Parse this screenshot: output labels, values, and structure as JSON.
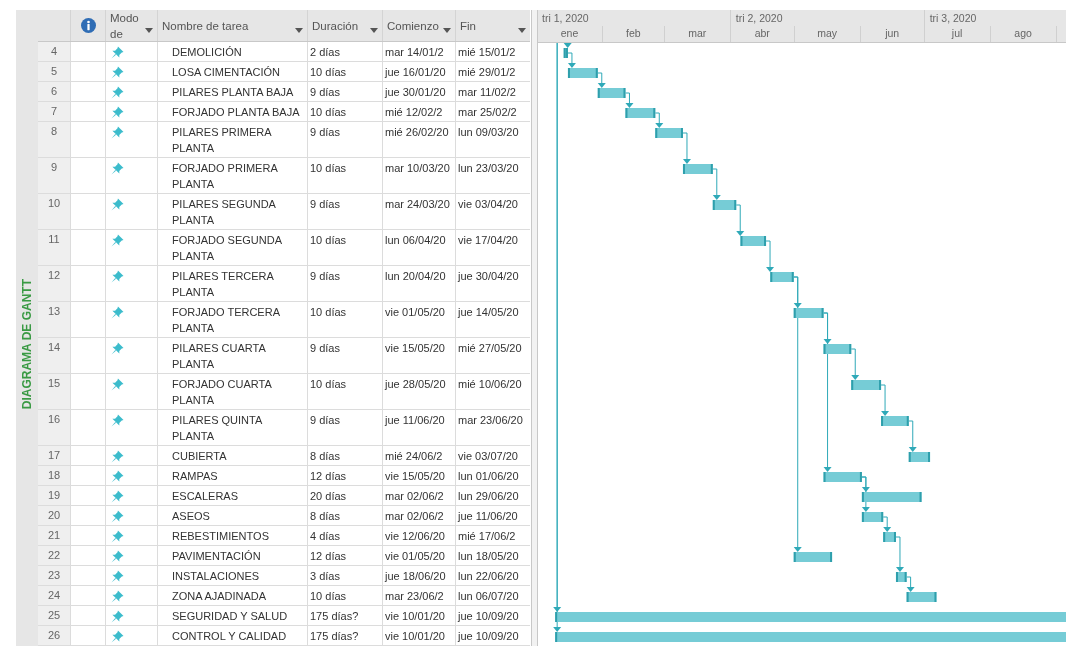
{
  "side_label": "DIAGRAMA DE GANTT",
  "table": {
    "columns": [
      {
        "kind": "info"
      },
      {
        "kind": "sortable",
        "label": "Modo de"
      },
      {
        "kind": "sortable",
        "label": "Nombre de tarea"
      },
      {
        "kind": "sortable",
        "label": "Duración"
      },
      {
        "kind": "sortable",
        "label": "Comienzo"
      },
      {
        "kind": "sortable",
        "label": "Fin"
      }
    ],
    "rows": [
      {
        "id": "4",
        "name": "DEMOLICIÓN",
        "duration": "2 días",
        "start": "mar 14/01/2",
        "end": "mié 15/01/2"
      },
      {
        "id": "5",
        "name": "LOSA CIMENTACIÓN",
        "duration": "10 días",
        "start": "jue 16/01/20",
        "end": "mié 29/01/2"
      },
      {
        "id": "6",
        "name": "PILARES PLANTA BAJA",
        "duration": "9 días",
        "start": "jue 30/01/20",
        "end": "mar 11/02/2"
      },
      {
        "id": "7",
        "name": "FORJADO PLANTA BAJA",
        "duration": "10 días",
        "start": "mié 12/02/2",
        "end": "mar 25/02/2"
      },
      {
        "id": "8",
        "name": "PILARES PRIMERA PLANTA",
        "duration": "9 días",
        "start": "mié 26/02/20",
        "end": "lun 09/03/20"
      },
      {
        "id": "9",
        "name": "FORJADO PRIMERA PLANTA",
        "duration": "10 días",
        "start": "mar 10/03/20",
        "end": "lun 23/03/20"
      },
      {
        "id": "10",
        "name": "PILARES SEGUNDA PLANTA",
        "duration": "9 días",
        "start": "mar 24/03/20",
        "end": "vie 03/04/20"
      },
      {
        "id": "11",
        "name": "FORJADO SEGUNDA PLANTA",
        "duration": "10 días",
        "start": "lun 06/04/20",
        "end": "vie 17/04/20"
      },
      {
        "id": "12",
        "name": "PILARES TERCERA PLANTA",
        "duration": "9 días",
        "start": "lun 20/04/20",
        "end": "jue 30/04/20"
      },
      {
        "id": "13",
        "name": "FORJADO TERCERA PLANTA",
        "duration": "10 días",
        "start": "vie 01/05/20",
        "end": "jue 14/05/20"
      },
      {
        "id": "14",
        "name": "PILARES CUARTA PLANTA",
        "duration": "9 días",
        "start": "vie 15/05/20",
        "end": "mié 27/05/20"
      },
      {
        "id": "15",
        "name": "FORJADO CUARTA PLANTA",
        "duration": "10 días",
        "start": "jue 28/05/20",
        "end": "mié 10/06/20"
      },
      {
        "id": "16",
        "name": "PILARES QUINTA PLANTA",
        "duration": "9 días",
        "start": "jue 11/06/20",
        "end": "mar 23/06/20"
      },
      {
        "id": "17",
        "name": "CUBIERTA",
        "duration": "8 días",
        "start": "mié 24/06/2",
        "end": "vie 03/07/20"
      },
      {
        "id": "18",
        "name": "RAMPAS",
        "duration": "12 días",
        "start": "vie 15/05/20",
        "end": "lun 01/06/20"
      },
      {
        "id": "19",
        "name": "ESCALERAS",
        "duration": "20 días",
        "start": "mar 02/06/2",
        "end": "lun 29/06/20"
      },
      {
        "id": "20",
        "name": "ASEOS",
        "duration": "8 días",
        "start": "mar 02/06/2",
        "end": "jue 11/06/20"
      },
      {
        "id": "21",
        "name": "REBESTIMIENTOS",
        "duration": "4 días",
        "start": "vie 12/06/20",
        "end": "mié 17/06/2"
      },
      {
        "id": "22",
        "name": "PAVIMENTACIÓN",
        "duration": "12 días",
        "start": "vie 01/05/20",
        "end": "lun 18/05/20"
      },
      {
        "id": "23",
        "name": "INSTALACIONES",
        "duration": "3 días",
        "start": "jue 18/06/20",
        "end": "lun 22/06/20"
      },
      {
        "id": "24",
        "name": "ZONA AJADINADA",
        "duration": "10 días",
        "start": "mar 23/06/2",
        "end": "lun 06/07/20"
      },
      {
        "id": "25",
        "name": "SEGURIDAD Y SALUD",
        "duration": "175 días?",
        "start": "vie 10/01/20",
        "end": "jue 10/09/20"
      },
      {
        "id": "26",
        "name": "CONTROL Y CALIDAD",
        "duration": "175 días?",
        "start": "vie 10/01/20",
        "end": "jue 10/09/20"
      }
    ]
  },
  "timescale": {
    "quarters": [
      "tri 1, 2020",
      "tri 2, 2020",
      "tri 3, 2020"
    ],
    "months": [
      "ene",
      "feb",
      "mar",
      "abr",
      "may",
      "jun",
      "jul",
      "ago"
    ]
  }
}
